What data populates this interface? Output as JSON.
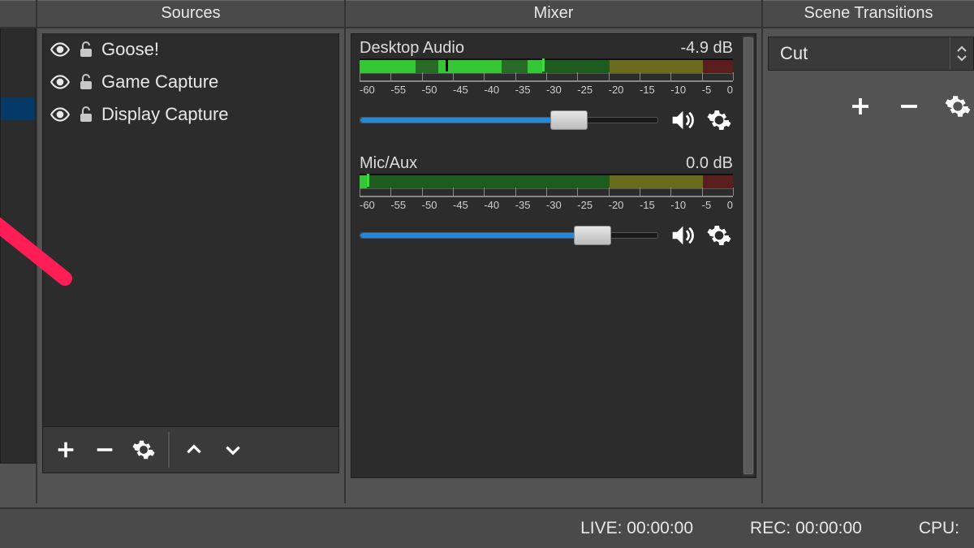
{
  "panels": {
    "sources_title": "Sources",
    "mixer_title": "Mixer",
    "transitions_title": "Scene Transitions"
  },
  "sources": {
    "items": [
      {
        "name": "Goose!",
        "visible": true,
        "locked": false
      },
      {
        "name": "Game Capture",
        "visible": true,
        "locked": false
      },
      {
        "name": "Display Capture",
        "visible": true,
        "locked": false
      }
    ]
  },
  "mixer": {
    "tick_labels": [
      "-60",
      "-55",
      "-50",
      "-45",
      "-40",
      "-35",
      "-30",
      "-25",
      "-20",
      "-15",
      "-10",
      "-5",
      "0"
    ],
    "channels": [
      {
        "name": "Desktop Audio",
        "db_text": "-4.9 dB",
        "level_norm": 0.38,
        "peak_norm": 0.49,
        "slider_norm": 0.7
      },
      {
        "name": "Mic/Aux",
        "db_text": "0.0 dB",
        "level_norm": 0.02,
        "peak_norm": 0.02,
        "slider_norm": 0.78
      }
    ]
  },
  "transitions": {
    "selected": "Cut"
  },
  "status": {
    "live_label": "LIVE:",
    "live_time": "00:00:00",
    "rec_label": "REC:",
    "rec_time": "00:00:00",
    "cpu_label": "CPU:"
  },
  "colors": {
    "accent_blue": "#1f8ae0",
    "meter_green": "#34c634",
    "meter_yellow": "#c2c234",
    "meter_red": "#bb2a2a",
    "bg_panel": "#2c2c2c",
    "bg_chrome": "#4a4a4a"
  }
}
